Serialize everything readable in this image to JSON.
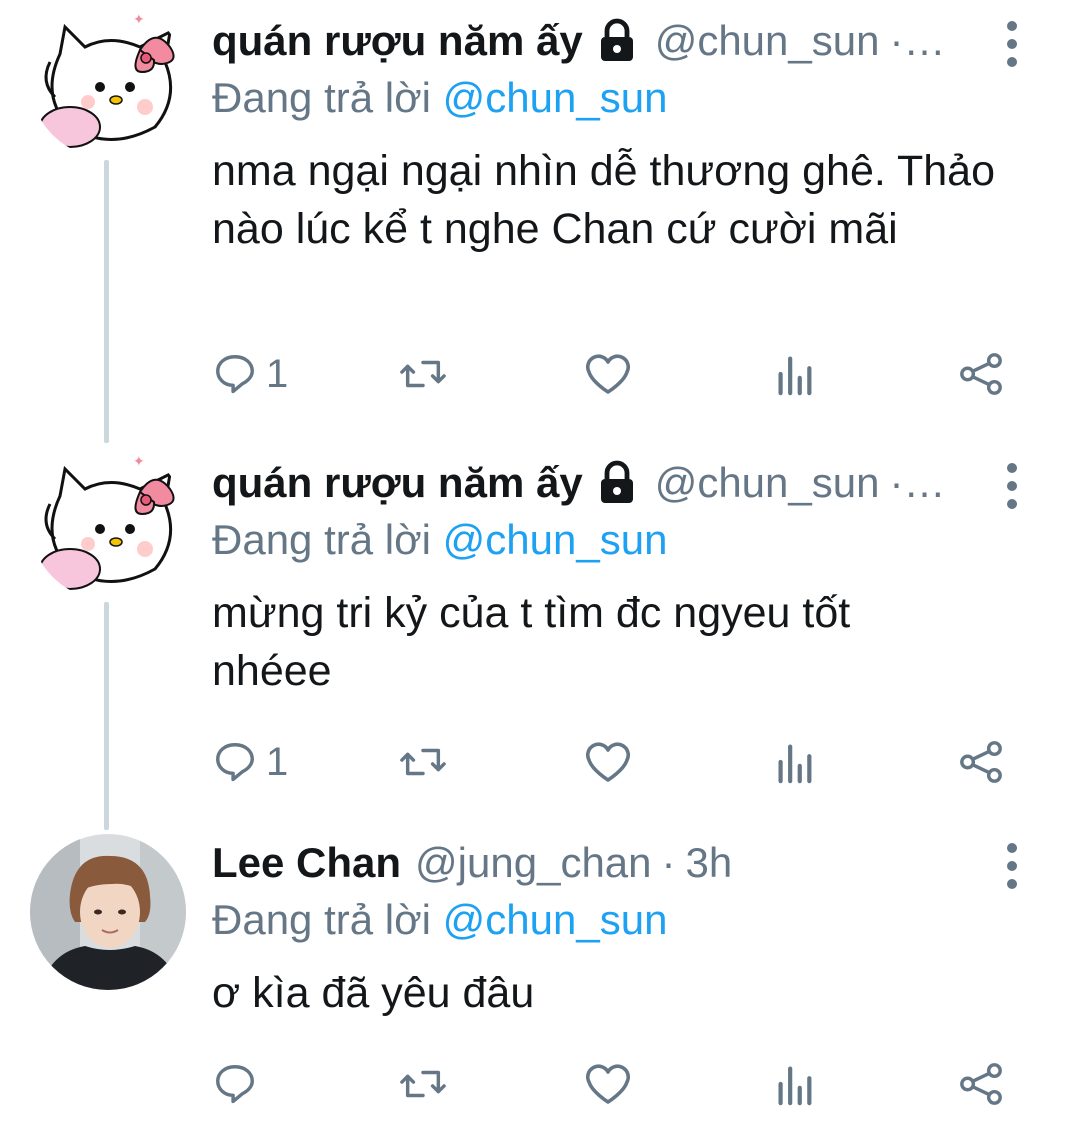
{
  "tweets": [
    {
      "display_name": "quán rượu năm ấy",
      "handle": "@chun_sun",
      "time_suffix": "·…",
      "replying_prefix": "Đang trả lời",
      "replying_to": "@chun_sun",
      "text": "nma ngại ngại nhìn dễ thương ghê. Thảo nào lúc kể t nghe Chan cứ cười mãi",
      "reply_count": "1",
      "avatar": "hello-kitty-avatar"
    },
    {
      "display_name": "quán rượu năm ấy",
      "handle": "@chun_sun",
      "time_suffix": "·…",
      "replying_prefix": "Đang trả lời",
      "replying_to": "@chun_sun",
      "text": "mừng tri kỷ của t tìm đc ngyeu tốt nhéee",
      "reply_count": "1",
      "avatar": "hello-kitty-avatar"
    },
    {
      "display_name": "Lee Chan",
      "handle": "@jung_chan",
      "time_suffix": "·",
      "time": "3h",
      "replying_prefix": "Đang trả lời",
      "replying_to": "@chun_sun",
      "text": "ơ kìa đã yêu đâu",
      "reply_count": "",
      "avatar": "profile-photo-avatar"
    }
  ],
  "colors": {
    "text": "#14171a",
    "secondary": "#657786",
    "link": "#1da1f2",
    "thread_line": "#ccd6dd",
    "kitty_bow": "#f28aa0"
  },
  "icons": [
    "reply-icon",
    "retweet-icon",
    "like-icon",
    "analytics-icon",
    "share-icon",
    "lock-icon",
    "more-icon"
  ]
}
